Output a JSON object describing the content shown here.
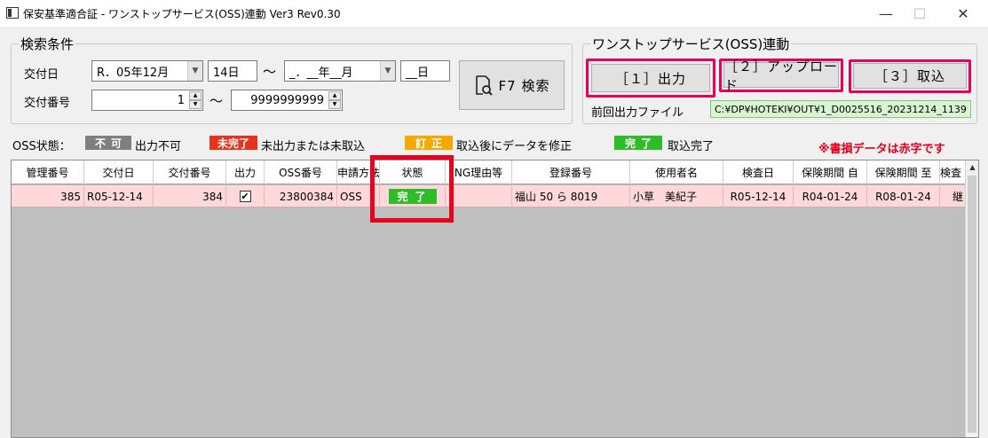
{
  "window": {
    "title": "保安基準適合証 - ワンストップサービス(OSS)連動 Ver3 Rev0.30",
    "minimize": "—",
    "maximize": "☐",
    "close": "✕"
  },
  "search": {
    "legend": "検索条件",
    "issue_date_label": "交付日",
    "date_from_month": "R．05年12月",
    "date_from_day": "14日",
    "tilde1": "～",
    "date_to_month": "_．__年__月",
    "date_to_day": "__日",
    "issue_no_label": "交付番号",
    "no_from": "1",
    "tilde2": "～",
    "no_to": "9999999999",
    "search_button": "F7 検索"
  },
  "oss": {
    "legend": "ワンストップサービス(OSS)連動",
    "output_button": "［１］出力",
    "upload_button": "［２］アップロード",
    "import_button": "［３］取込",
    "last_output_label": "前回出力ファイル",
    "last_output_path": "C:¥DP¥HOTEKI¥OUT¥1_D0025516_20231214_1139"
  },
  "status_legend": {
    "label": "OSS状態：",
    "items": [
      {
        "badge": "不可",
        "text": "出力不可",
        "color": "#7f7f7f"
      },
      {
        "badge": "未完了",
        "text": "未出力または未取込",
        "color": "#e8331c"
      },
      {
        "badge": "訂正",
        "text": "取込後にデータを修正",
        "color": "#f2a900"
      },
      {
        "badge": "完了",
        "text": "取込完了",
        "color": "#2ebd26"
      }
    ],
    "note": "※書損データは赤字です"
  },
  "grid": {
    "headers": [
      "管理番号",
      "交付日",
      "交付番号",
      "出力",
      "OSS番号",
      "申請方法",
      "状態",
      "NG理由等",
      "登録番号",
      "使用者名",
      "検査日",
      "保険期間 自",
      "保険期間 至",
      "検査"
    ],
    "rows": [
      {
        "mgmt_no": "385",
        "issue_date": "R05-12-14",
        "issue_no": "384",
        "output_checked": "✔",
        "oss_no": "23800384",
        "method": "OSS",
        "status": "完了",
        "ng_reason": "",
        "reg_no": "福山 50 ら 8019",
        "user_name": "小草　美紀子",
        "inspect_date": "R05-12-14",
        "ins_from": "R04-01-24",
        "ins_to": "R08-01-24",
        "inspect": "継"
      }
    ]
  }
}
